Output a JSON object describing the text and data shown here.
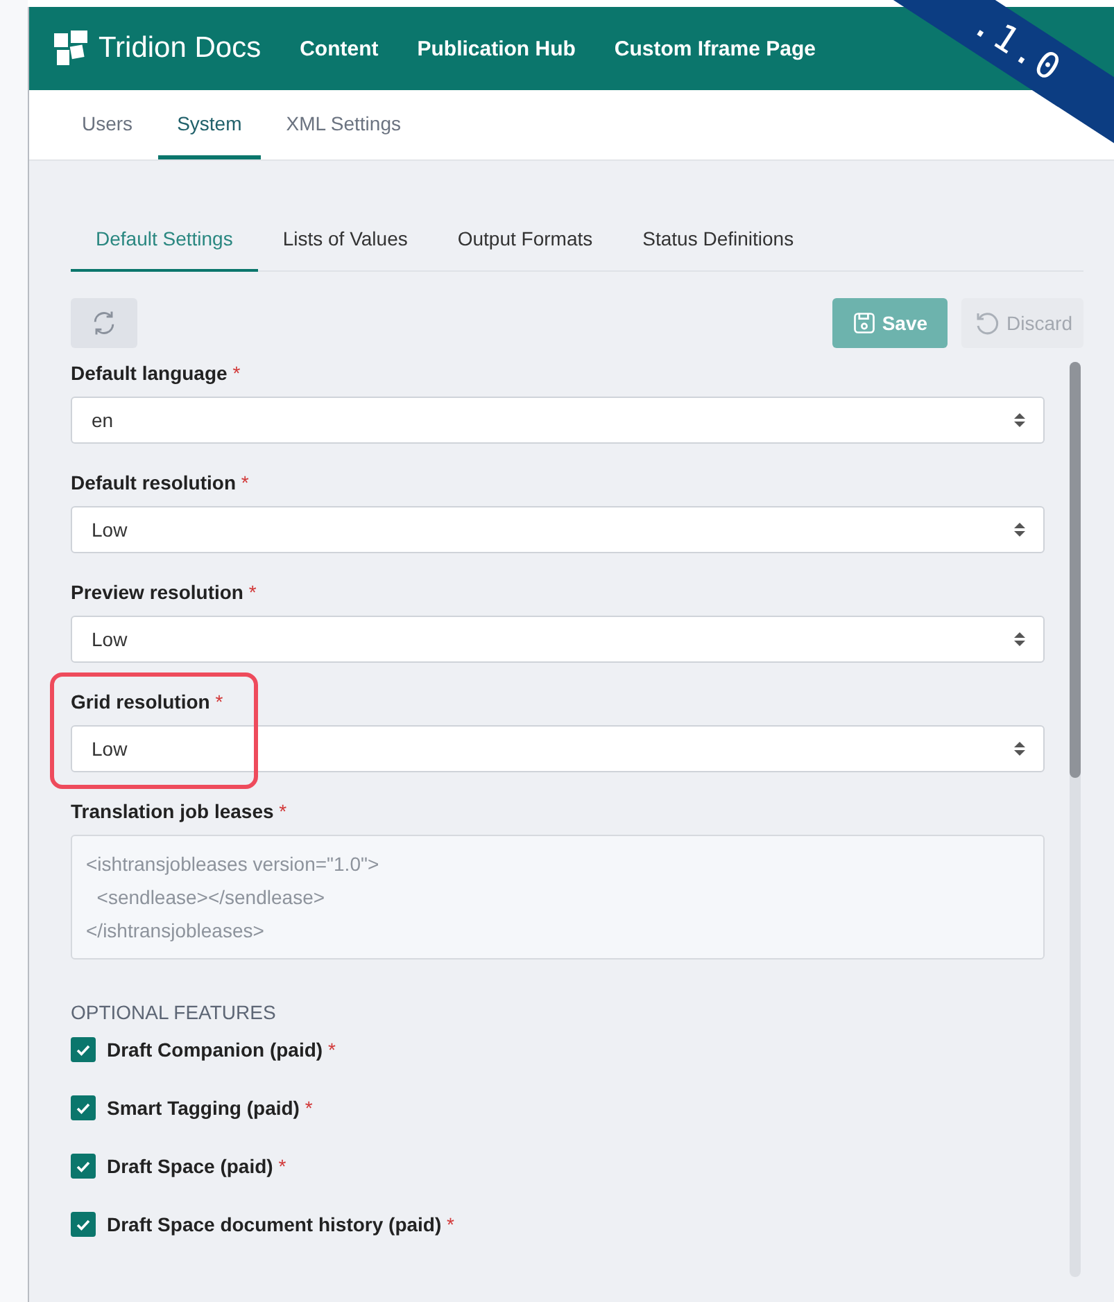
{
  "header": {
    "brand": "Tridion Docs",
    "nav": [
      {
        "label": "Content"
      },
      {
        "label": "Publication Hub"
      },
      {
        "label": "Custom Iframe Page"
      }
    ]
  },
  "version_ribbon": ".1.0",
  "tabs": [
    {
      "label": "Users",
      "selected": false
    },
    {
      "label": "System",
      "selected": true
    },
    {
      "label": "XML Settings",
      "selected": false
    }
  ],
  "subtabs": [
    {
      "label": "Default Settings",
      "selected": true
    },
    {
      "label": "Lists of Values",
      "selected": false
    },
    {
      "label": "Output Formats",
      "selected": false
    },
    {
      "label": "Status Definitions",
      "selected": false
    }
  ],
  "toolbar": {
    "save": {
      "label": "Save",
      "disabled": true
    },
    "discard": {
      "label": "Discard",
      "disabled": true
    }
  },
  "fields": [
    {
      "kind": "select",
      "label": "Default language",
      "required": "*",
      "value": "en",
      "highlighted": false
    },
    {
      "kind": "select",
      "label": "Default resolution",
      "required": "*",
      "value": "Low",
      "highlighted": false
    },
    {
      "kind": "select",
      "label": "Preview resolution",
      "required": "*",
      "value": "Low",
      "highlighted": false
    },
    {
      "kind": "select",
      "label": "Grid resolution",
      "required": "*",
      "value": "Low",
      "highlighted": true
    },
    {
      "kind": "textarea",
      "label": "Translation job leases",
      "required": "*",
      "lines": [
        "<ishtransjobleases version=\"1.0\">",
        "  <sendlease></sendlease>",
        "</ishtransjobleases>"
      ],
      "highlighted": false
    }
  ],
  "optional_features": {
    "heading": "OPTIONAL FEATURES",
    "items": [
      {
        "label": "Draft Companion (paid)",
        "required": "*",
        "checked": true
      },
      {
        "label": "Smart Tagging (paid)",
        "required": "*",
        "checked": true
      },
      {
        "label": "Draft Space (paid)",
        "required": "*",
        "checked": true
      },
      {
        "label": "Draft Space document history (paid)",
        "required": "*",
        "checked": true
      }
    ]
  }
}
